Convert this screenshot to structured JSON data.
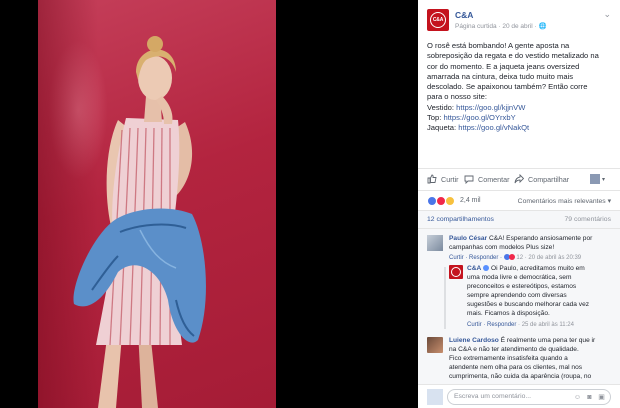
{
  "photo": {
    "alt": ""
  },
  "post": {
    "page_name": "C&A",
    "logo_text": "C&A",
    "meta": "Página curtida · 20 de abril · ",
    "lines": [
      "O rosê está bombando! A gente aposta na",
      "sobreposição da regata e do vestido metalizado na",
      "cor do momento. E a jaqueta jeans oversized",
      "amarrada na cintura, deixa tudo muito mais",
      "descolado. Se apaixonou também? Então corre",
      "para o nosso site:"
    ],
    "links": [
      {
        "label": "Vestido: ",
        "url": "https://goo.gl/kjjnVW"
      },
      {
        "label": "Top: ",
        "url": "https://goo.gl/OYrxbY"
      },
      {
        "label": "Jaqueta: ",
        "url": "https://goo.gl/vNakQt"
      }
    ]
  },
  "actions": {
    "like": "Curtir",
    "comment": "Comentar",
    "share": "Compartilhar"
  },
  "reactions": {
    "count": "2,4 mil",
    "sort": "Comentários mais relevantes ▾"
  },
  "stats": {
    "shares": "12 compartilhamentos",
    "comments": "79 comentários"
  },
  "comments": [
    {
      "author": "Paulo César",
      "text_lines": [
        " C&A! Esperando ansiosamente por",
        "campanhas com modelos Plus size!"
      ],
      "like": "Curtir",
      "reply": "Responder",
      "reactions": "12",
      "time": "20 de abril às 20:39"
    },
    {
      "author": "C&A",
      "text_lines": [
        " Oi Paulo, acreditamos muito em",
        "uma moda livre e democrática, sem",
        "preconceitos e estereótipos, estamos",
        "sempre aprendendo com diversas",
        "sugestões e buscando melhorar cada vez",
        "mais. Ficamos à disposição."
      ],
      "like": "Curtir",
      "reply": "Responder",
      "time": "25 de abril às 11:24"
    },
    {
      "author": "Luiene Cardoso",
      "text_lines": [
        " É realmente uma pena ter que ir",
        "na C&A e não ter atendimento de qualidade.",
        "Fico extremamente insatisfeita quando a",
        "atendente nem olha para os clientes, mal nos",
        "cumprimenta, não cuida da aparência (roupa, no"
      ]
    }
  ],
  "composer": {
    "placeholder": "Escreva um comentário..."
  },
  "colors": {
    "brand": "#c4131e",
    "link": "#365899",
    "backdrop": "#b3243f"
  }
}
